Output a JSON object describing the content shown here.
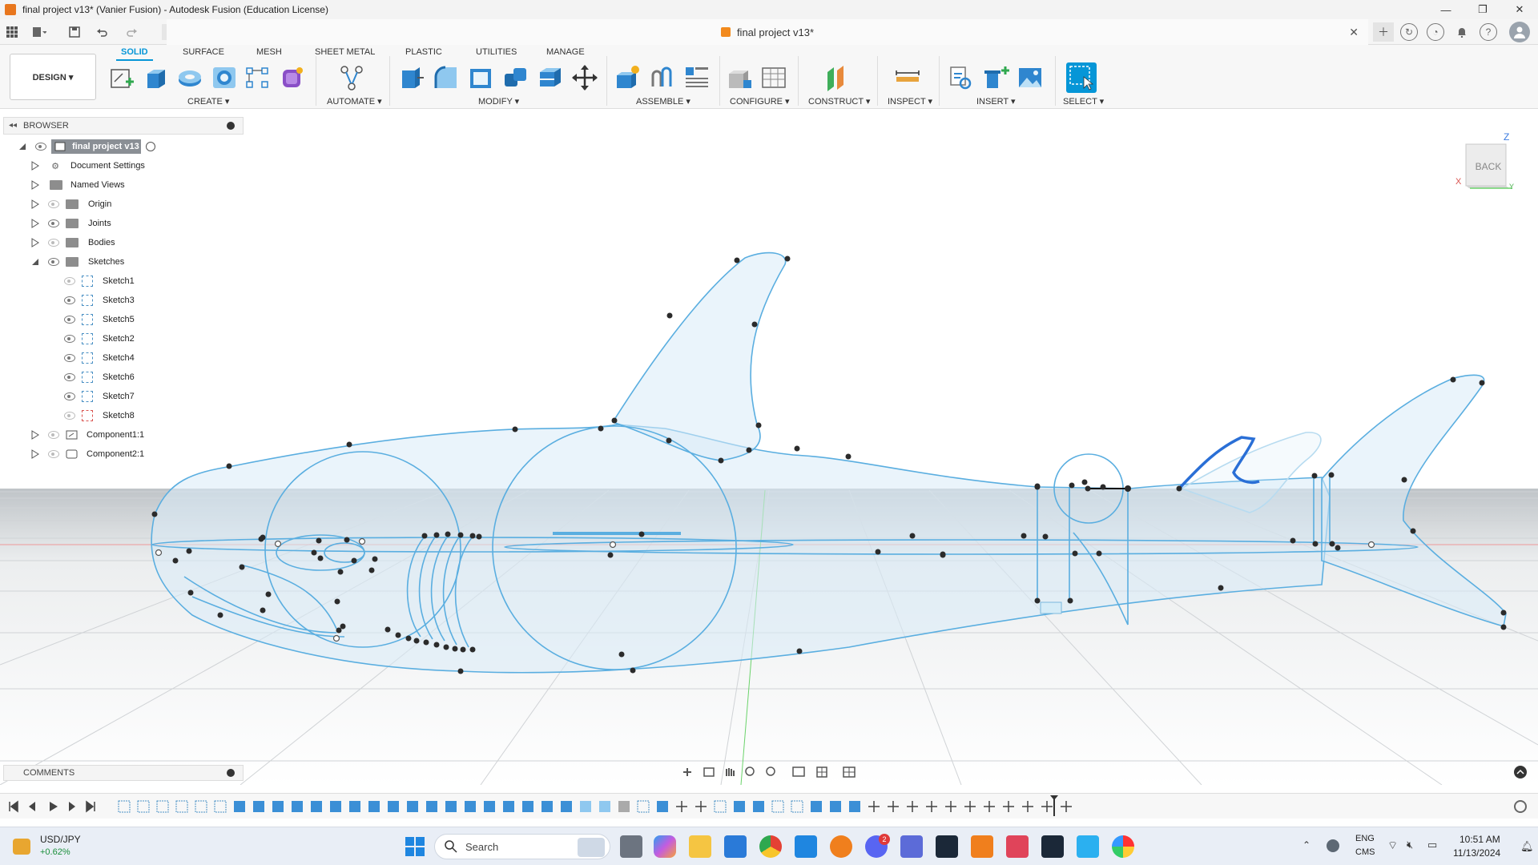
{
  "window": {
    "title": "final project v13* (Vanier Fusion) - Autodesk Fusion (Education License)",
    "controls": [
      "—",
      "❐",
      "✕"
    ]
  },
  "doc_tab": {
    "name": "final project v13*",
    "close": "✕"
  },
  "toolbar": {
    "design_label": "DESIGN ▾",
    "workspace_tabs": [
      "SOLID",
      "SURFACE",
      "MESH",
      "SHEET METAL",
      "PLASTIC",
      "UTILITIES",
      "MANAGE"
    ],
    "groups": [
      "CREATE ▾",
      "AUTOMATE ▾",
      "MODIFY ▾",
      "ASSEMBLE ▾",
      "CONFIGURE ▾",
      "CONSTRUCT ▾",
      "INSPECT ▾",
      "INSERT ▾",
      "SELECT ▾"
    ]
  },
  "browser": {
    "title": "BROWSER",
    "root": "final project v13",
    "items": [
      {
        "label": "Document Settings"
      },
      {
        "label": "Named Views"
      },
      {
        "label": "Origin"
      },
      {
        "label": "Joints"
      },
      {
        "label": "Bodies"
      },
      {
        "label": "Sketches"
      },
      {
        "label": "Sketch1"
      },
      {
        "label": "Sketch3"
      },
      {
        "label": "Sketch5"
      },
      {
        "label": "Sketch2"
      },
      {
        "label": "Sketch4"
      },
      {
        "label": "Sketch6"
      },
      {
        "label": "Sketch7"
      },
      {
        "label": "Sketch8"
      },
      {
        "label": "Component1:1"
      },
      {
        "label": "Component2:1"
      }
    ]
  },
  "viewcube": {
    "face": "BACK",
    "axis_z": "Z",
    "axis_x": "X",
    "axis_y": "Y"
  },
  "comments": {
    "title": "COMMENTS"
  },
  "taskbar": {
    "ticker_name": "USD/JPY",
    "ticker_change": "+0.62%",
    "search_placeholder": "Search",
    "lang_top": "ENG",
    "lang_bottom": "CMS",
    "time": "10:51 AM",
    "date": "11/13/2024",
    "discord_badge": "2"
  },
  "colors": {
    "accent": "#0696d7",
    "sketch_line": "#5aaee0",
    "sketch_fill": "#d8ebf7",
    "point": "#2b2b2b",
    "selected_curve": "#2a6fd6"
  }
}
